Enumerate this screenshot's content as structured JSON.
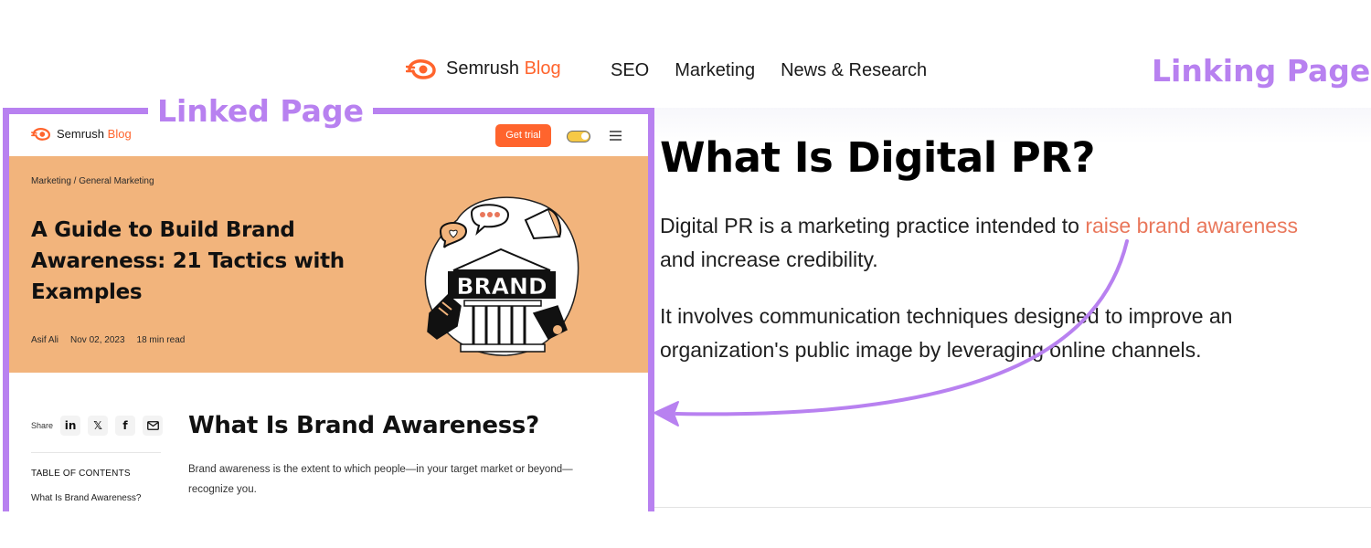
{
  "colors": {
    "annotation": "#b881f0",
    "brand_orange": "#ff642d",
    "link_orange": "#e9775b",
    "hero_bg": "#f2b47c"
  },
  "annotations": {
    "linking_page": "Linking Page",
    "linked_page": "Linked Page"
  },
  "top": {
    "logo_text": "Semrush",
    "logo_accent": "Blog",
    "nav": [
      "SEO",
      "Marketing",
      "News & Research"
    ]
  },
  "linking_page": {
    "title": "What Is Digital PR?",
    "p1_before": "Digital PR is a marketing practice intended to ",
    "p1_link": "raise brand awareness",
    "p1_after": " and increase credibility.",
    "p2": "It involves communication techniques designed to improve an organization's public image by leveraging online channels."
  },
  "linked_page": {
    "logo_text": "Semrush",
    "logo_accent": "Blog",
    "get_trial": "Get trial",
    "breadcrumb": [
      "Marketing",
      "General Marketing"
    ],
    "breadcrumb_sep": " / ",
    "hero_title": "A Guide to Build Brand Awareness: 21 Tactics with Examples",
    "meta": {
      "author": "Asif Ali",
      "date": "Nov 02, 2023",
      "read_time": "18 min read"
    },
    "illustration_text": "BRAND",
    "share_label": "Share",
    "share_icons": [
      "linkedin-icon",
      "x-icon",
      "facebook-icon",
      "email-icon"
    ],
    "share_glyphs": {
      "linkedin": "in",
      "x": "𝕏",
      "facebook": "f"
    },
    "toc_heading": "TABLE OF CONTENTS",
    "toc_items": [
      "What Is Brand Awareness?"
    ],
    "article_heading": "What Is Brand Awareness?",
    "article_text": "Brand awareness is the extent to which people—in your target market or beyond—recognize you."
  }
}
